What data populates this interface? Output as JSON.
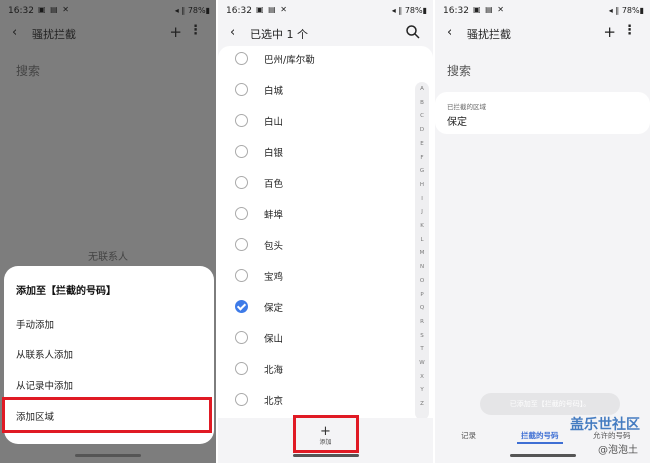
{
  "status": {
    "time": "16:32",
    "battery": "78%"
  },
  "panel1": {
    "title": "骚扰拦截",
    "search": "搜索",
    "empty": "无联系人",
    "sheet_title": "添加至【拦截的号码】",
    "options": [
      "手动添加",
      "从联系人添加",
      "从记录中添加",
      "添加区域"
    ]
  },
  "panel2": {
    "title": "已选中 1 个",
    "items": [
      {
        "name": "巴州/库尔勒",
        "checked": false
      },
      {
        "name": "白城",
        "checked": false
      },
      {
        "name": "白山",
        "checked": false
      },
      {
        "name": "白银",
        "checked": false
      },
      {
        "name": "百色",
        "checked": false
      },
      {
        "name": "蚌埠",
        "checked": false
      },
      {
        "name": "包头",
        "checked": false
      },
      {
        "name": "宝鸡",
        "checked": false
      },
      {
        "name": "保定",
        "checked": true
      },
      {
        "name": "保山",
        "checked": false
      },
      {
        "name": "北海",
        "checked": false
      },
      {
        "name": "北京",
        "checked": false
      }
    ],
    "index_letters": [
      "A",
      "B",
      "C",
      "D",
      "E",
      "F",
      "G",
      "H",
      "I",
      "J",
      "K",
      "L",
      "M",
      "N",
      "O",
      "P",
      "Q",
      "R",
      "S",
      "T",
      "W",
      "X",
      "Y",
      "Z"
    ],
    "add_plus": "+",
    "add_label": "添加"
  },
  "panel3": {
    "title": "骚扰拦截",
    "search": "搜索",
    "card_label": "已拦截的区域",
    "card_value": "保定",
    "toast": "已添加至【拦截的号码】。",
    "tabs": [
      "记录",
      "拦截的号码",
      "允许的号码"
    ],
    "watermark_main": "盖乐世社区",
    "watermark_user": "@泡泡土"
  },
  "colors": {
    "accent": "#3e7be8",
    "highlight": "#e01a24"
  }
}
